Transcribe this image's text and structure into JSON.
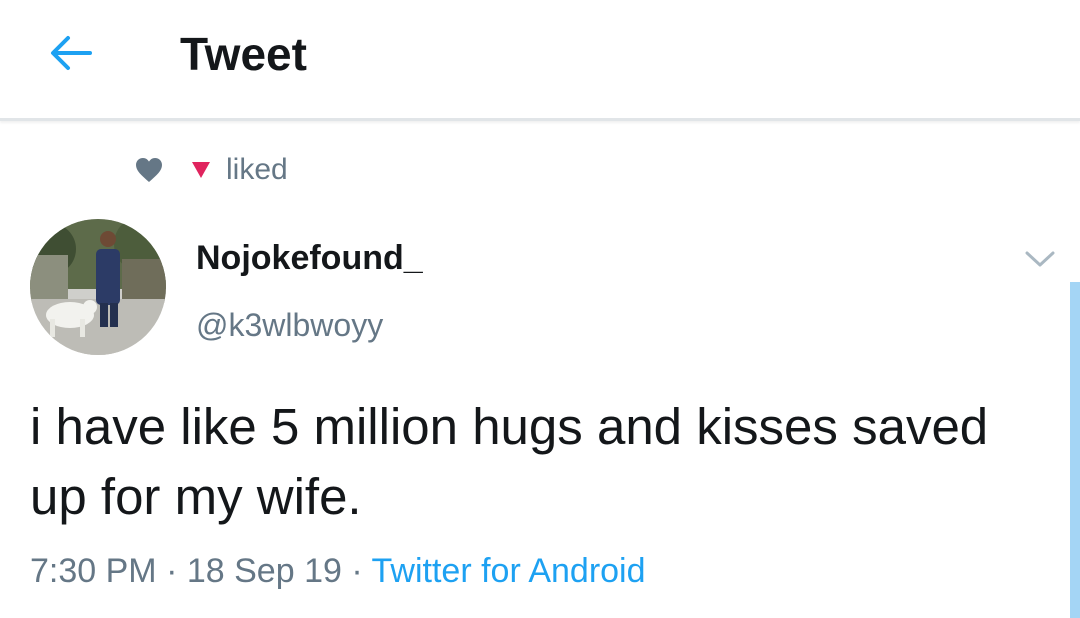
{
  "header": {
    "title": "Tweet",
    "back_icon": "arrow-left-icon"
  },
  "social_context": {
    "text": "liked",
    "icon": "heart-icon",
    "badge_icon": "red-triangle-icon"
  },
  "tweet": {
    "author_name": "Nojokefound_",
    "author_handle": "@k3wlbwoyy",
    "text": "i have like 5 million hugs and kisses saved up for my wife.",
    "time": "7:30 PM",
    "date": "18 Sep 19",
    "separator": "·",
    "source": "Twitter for Android"
  },
  "colors": {
    "accent": "#1da1f2",
    "muted": "#657786",
    "text": "#14171a",
    "badge": "#e0245e"
  }
}
